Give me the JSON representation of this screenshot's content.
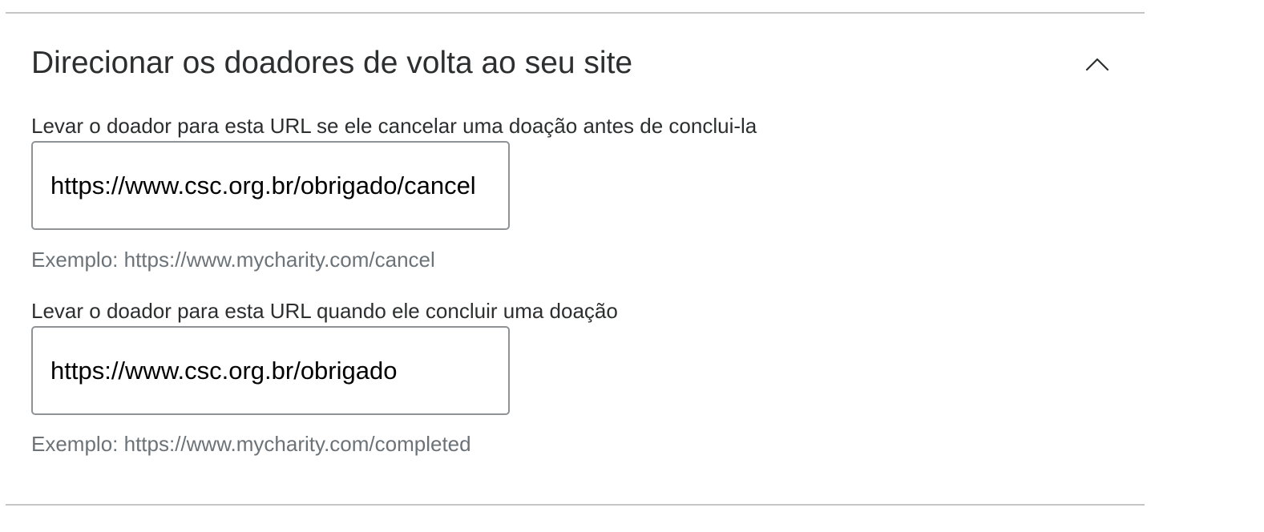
{
  "section": {
    "title": "Direcionar os doadores de volta ao seu site",
    "toggle_icon": "chevron-up-icon",
    "colors": {
      "divider": "#c3c5c7",
      "text": "#2c2e2f",
      "help_text": "#6c7378",
      "input_border": "#909396"
    }
  },
  "fields": [
    {
      "label": "Levar o doador para esta URL se ele cancelar uma doação antes de conclui-la",
      "value": "https://www.csc.org.br/obrigado/cancel",
      "help": "Exemplo: https://www.mycharity.com/cancel"
    },
    {
      "label": "Levar o doador para esta URL quando ele concluir uma doação",
      "value": "https://www.csc.org.br/obrigado",
      "help": "Exemplo: https://www.mycharity.com/completed"
    }
  ]
}
